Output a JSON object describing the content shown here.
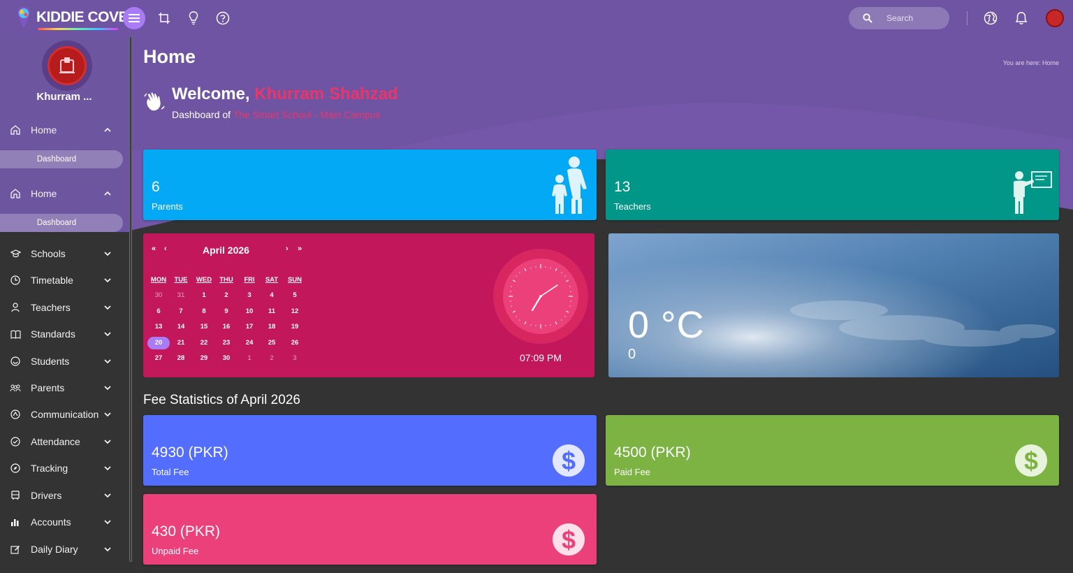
{
  "brand": {
    "name": "KIDDIE COVE"
  },
  "topbar": {
    "search_placeholder": "Search",
    "icons": [
      "menu-icon",
      "crop-icon",
      "lightbulb-icon",
      "help-icon",
      "search-icon",
      "globe-icon",
      "bell-icon",
      "avatar"
    ]
  },
  "sidebar": {
    "profile_name": "Khurram ...",
    "groups": [
      {
        "label": "Home",
        "sub": "Dashboard"
      },
      {
        "label": "Home",
        "sub": "Dashboard"
      }
    ],
    "items": [
      {
        "label": "Schools",
        "icon": "school-icon"
      },
      {
        "label": "Timetable",
        "icon": "clock-icon"
      },
      {
        "label": "Teachers",
        "icon": "person-icon"
      },
      {
        "label": "Standards",
        "icon": "book-icon"
      },
      {
        "label": "Students",
        "icon": "smile-icon"
      },
      {
        "label": "Parents",
        "icon": "group-icon"
      },
      {
        "label": "Communication",
        "icon": "chat-icon"
      },
      {
        "label": "Attendance",
        "icon": "check-circle-icon"
      },
      {
        "label": "Tracking",
        "icon": "compass-icon"
      },
      {
        "label": "Drivers",
        "icon": "bus-icon"
      },
      {
        "label": "Accounts",
        "icon": "bar-chart-icon"
      },
      {
        "label": "Daily Diary",
        "icon": "edit-icon"
      }
    ]
  },
  "page": {
    "title": "Home",
    "breadcrumb_prefix": "You are here:",
    "breadcrumb_current": "Home",
    "welcome_prefix": "Welcome,",
    "user_name": "Khurram Shahzad",
    "dashboard_of": "Dashboard of",
    "school_name": "The Smart School - Main Campus"
  },
  "stats": {
    "parents": {
      "value": "6",
      "label": "Parents",
      "color": "#03a9f4"
    },
    "teachers": {
      "value": "13",
      "label": "Teachers",
      "color": "#009688"
    }
  },
  "calendar": {
    "prev_year": "«",
    "prev_month": "‹",
    "next_month": "›",
    "next_year": "»",
    "month_label": "April 2026",
    "weekdays": [
      "MON",
      "TUE",
      "WED",
      "THU",
      "FRI",
      "SAT",
      "SUN"
    ],
    "weeks": [
      [
        "30",
        "31",
        "1",
        "2",
        "3",
        "4",
        "5"
      ],
      [
        "6",
        "7",
        "8",
        "9",
        "10",
        "11",
        "12"
      ],
      [
        "13",
        "14",
        "15",
        "16",
        "17",
        "18",
        "19"
      ],
      [
        "20",
        "21",
        "22",
        "23",
        "24",
        "25",
        "26"
      ],
      [
        "27",
        "28",
        "29",
        "30",
        "1",
        "2",
        "3"
      ]
    ],
    "today": "20",
    "color": "#c2185b"
  },
  "clock": {
    "time": "07:09 PM"
  },
  "weather": {
    "temperature": "0 °C",
    "detail": "0"
  },
  "fees": {
    "title": "Fee Statistics of April 2026",
    "total": {
      "value": "4930 (PKR)",
      "label": "Total Fee",
      "color": "#536dfe"
    },
    "paid": {
      "value": "4500 (PKR)",
      "label": "Paid Fee",
      "color": "#7cb342"
    },
    "unpaid": {
      "value": "430 (PKR)",
      "label": "Unpaid Fee",
      "color": "#ec407a"
    }
  },
  "colors": {
    "header": "#6f54a3",
    "sidebar": "#6d55a0",
    "background": "#333333",
    "accent": "#e8366b"
  }
}
